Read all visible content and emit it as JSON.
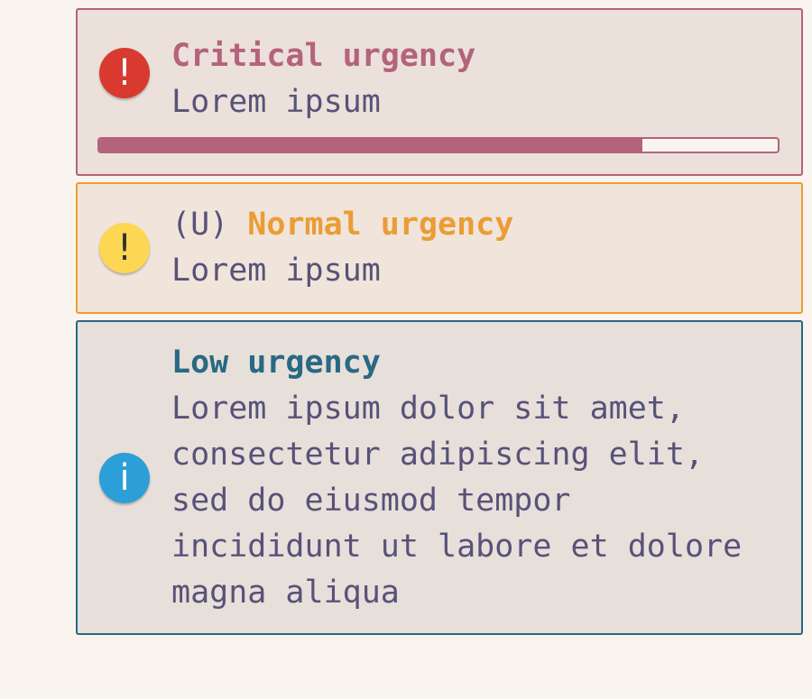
{
  "notifications": [
    {
      "urgency": "critical",
      "icon": "exclamation-icon",
      "icon_glyph": "!",
      "summary": "Critical urgency",
      "body": "Lorem ipsum",
      "progress": 0.8
    },
    {
      "urgency": "normal",
      "icon": "exclamation-icon",
      "icon_glyph": "!",
      "prefix": "(U)",
      "summary": "Normal urgency",
      "body": "Lorem ipsum"
    },
    {
      "urgency": "low",
      "icon": "info-icon",
      "icon_glyph": "i",
      "summary": "Low urgency",
      "body_lines": [
        "Lorem ipsum dolor sit amet,",
        "consectetur adipiscing elit,",
        "sed do eiusmod tempor",
        "incididunt ut labore et dolore",
        "magna aliqua"
      ]
    }
  ],
  "colors": {
    "critical": "#b4637a",
    "normal": "#ea9d34",
    "low": "#286983",
    "text": "#575279",
    "background": "#faf4ef"
  }
}
